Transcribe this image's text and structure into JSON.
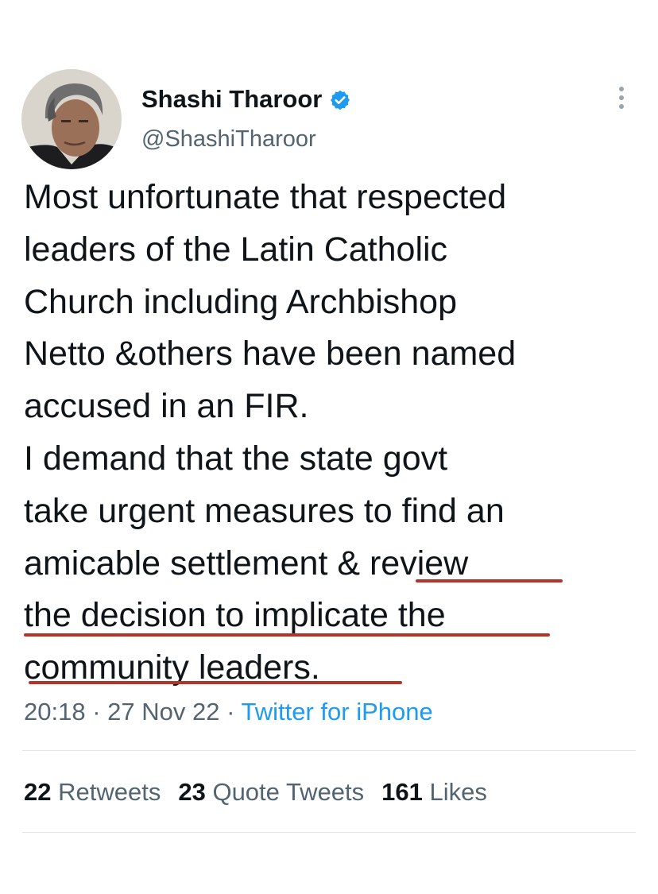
{
  "author": {
    "display_name": "Shashi Tharoor",
    "handle": "@ShashiTharoor",
    "verified": true,
    "verified_badge_color": "#1d9bf0"
  },
  "icons": {
    "verified": "verified-badge-icon",
    "more": "more-vertical-icon"
  },
  "tweet": {
    "lines": [
      "Most unfortunate that respected",
      "leaders of the Latin Catholic",
      "Church including Archbishop",
      "Netto &others have been named",
      "accused in an FIR.",
      "I demand that the state govt",
      "take urgent measures to find an",
      "amicable settlement & review",
      "the decision to implicate the",
      "community leaders."
    ],
    "underline_color": "#b5342a"
  },
  "meta": {
    "time": "20:18",
    "separator": "·",
    "date": "27 Nov 22",
    "source": "Twitter for iPhone"
  },
  "stats": {
    "retweets": {
      "count": "22",
      "label": "Retweets"
    },
    "quote_tweets": {
      "count": "23",
      "label": "Quote Tweets"
    },
    "likes": {
      "count": "161",
      "label": "Likes"
    }
  },
  "colors": {
    "text": "#0f1419",
    "secondary": "#536471",
    "link": "#1d9bf0",
    "divider": "#e1e6ea"
  }
}
